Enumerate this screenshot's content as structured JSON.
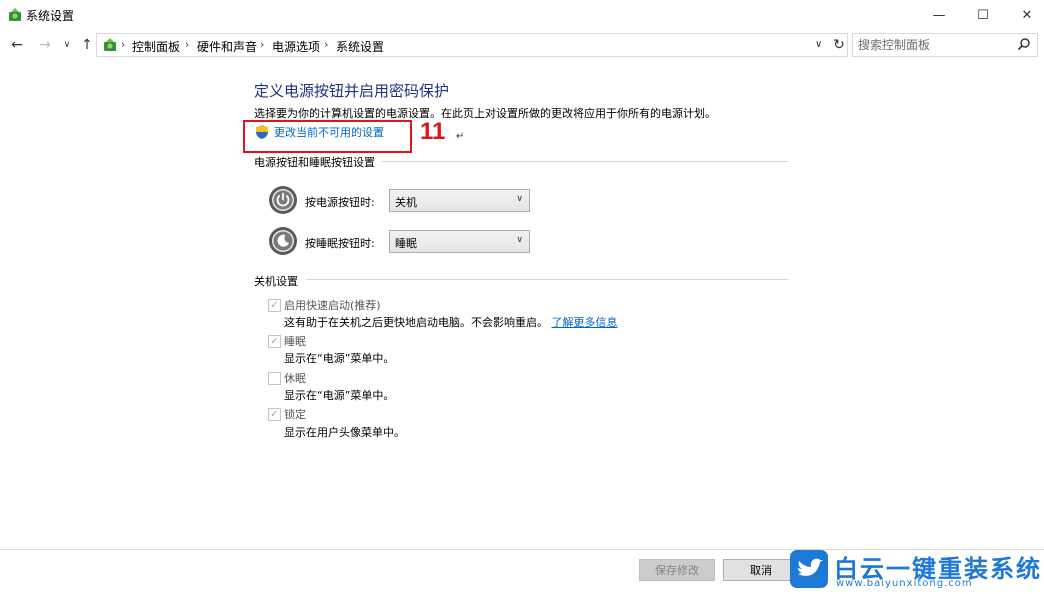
{
  "window": {
    "title": "系统设置",
    "minimize_glyph": "—",
    "maximize_glyph": "☐",
    "close_glyph": "✕"
  },
  "nav": {
    "back_glyph": "←",
    "forward_glyph": "→",
    "recent_glyph": "∨",
    "up_glyph": "↑",
    "refresh_glyph": "↻",
    "dropdown_glyph": "∨",
    "breadcrumbs": [
      {
        "label": "控制面板"
      },
      {
        "label": "硬件和声音"
      },
      {
        "label": "电源选项"
      },
      {
        "label": "系统设置"
      }
    ],
    "separator": "›"
  },
  "search": {
    "placeholder": "搜索控制面板"
  },
  "main": {
    "heading": "定义电源按钮并启用密码保护",
    "description": "选择要为你的计算机设置的电源设置。在此页上对设置所做的更改将应用于你所有的电源计划。",
    "change_link": "更改当前不可用的设置",
    "annotation_number": "11",
    "annotation_mark": "↵"
  },
  "power_section": {
    "title": "电源按钮和睡眠按钮设置",
    "rows": [
      {
        "label": "按电源按钮时:",
        "value": "关机"
      },
      {
        "label": "按睡眠按钮时:",
        "value": "睡眠"
      }
    ]
  },
  "shutdown_section": {
    "title": "关机设置",
    "items": [
      {
        "label": "启用快速启动(推荐)",
        "checked": true,
        "desc": "这有助于在关机之后更快地启动电脑。不会影响重启。",
        "link": "了解更多信息"
      },
      {
        "label": "睡眠",
        "checked": true,
        "desc": "显示在“电源”菜单中。"
      },
      {
        "label": "休眠",
        "checked": false,
        "desc": "显示在“电源”菜单中。"
      },
      {
        "label": "锁定",
        "checked": true,
        "desc": "显示在用户头像菜单中。"
      }
    ]
  },
  "buttons": {
    "save": "保存修改",
    "cancel": "取消"
  },
  "watermark": {
    "title": "白云一键重装系统",
    "url": "www.baiyunxitong.com"
  },
  "colors": {
    "heading": "#1e3287",
    "link": "#0066cc",
    "annotation": "#e0141e",
    "watermark": "#1e78d6"
  }
}
